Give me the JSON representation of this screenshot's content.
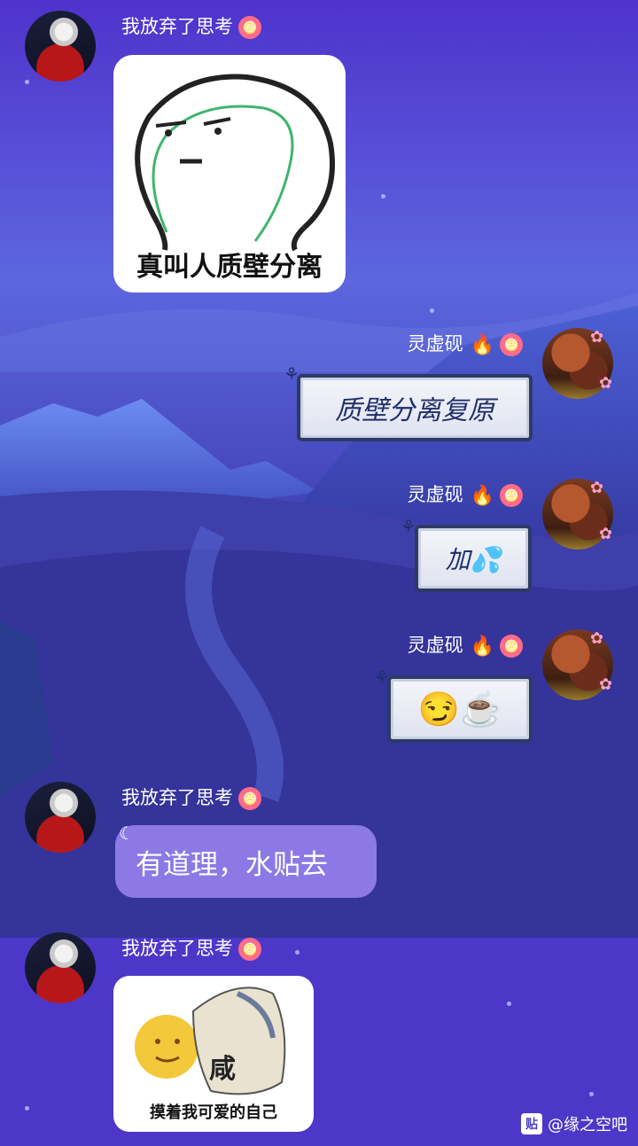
{
  "messages": [
    {
      "sender": "我放弃了思考",
      "type": "sticker",
      "caption": "真叫人质壁分离"
    },
    {
      "sender": "灵虚砚",
      "type": "text",
      "text": "质壁分离复原"
    },
    {
      "sender": "灵虚砚",
      "type": "text",
      "text": "加💦"
    },
    {
      "sender": "灵虚砚",
      "type": "emoji",
      "text": "😏☕"
    },
    {
      "sender": "我放弃了思考",
      "type": "text",
      "text": "有道理，水贴去"
    },
    {
      "sender": "我放弃了思考",
      "type": "sticker",
      "caption": "摸着我可爱的自己",
      "sticker_text": "咸"
    }
  ],
  "watermark": {
    "icon": "贴",
    "text": "@缘之空吧"
  },
  "colors": {
    "background": "#5a4fd6",
    "purple_bubble": "#8c79e6",
    "scroll_border": "#2d3a66"
  },
  "icons": {
    "badge": "flower-badge-icon",
    "fire": "fire-icon"
  }
}
